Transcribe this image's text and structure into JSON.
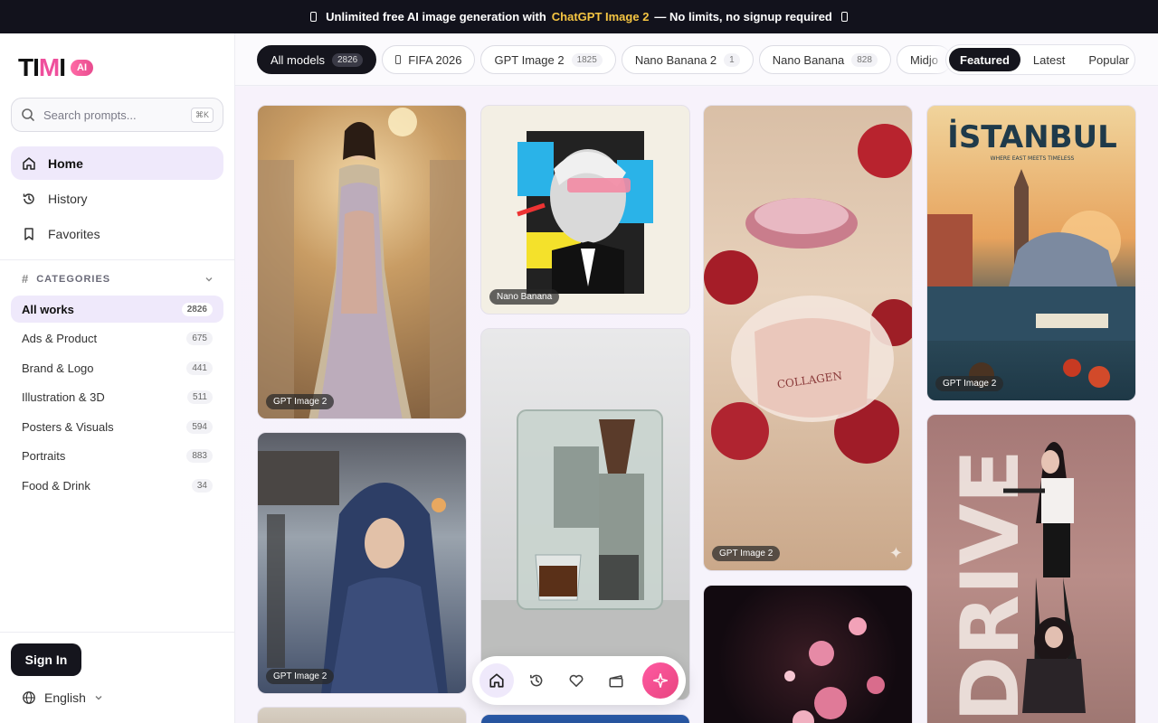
{
  "banner": {
    "prefix": "Unlimited free AI image generation with",
    "highlight": "ChatGPT Image 2",
    "suffix": "— No limits, no signup required"
  },
  "logo": {
    "text_a": "TI",
    "text_m": "M",
    "text_b": "I",
    "badge": "AI"
  },
  "search": {
    "placeholder": "Search prompts...",
    "shortcut": "⌘K"
  },
  "nav": [
    {
      "label": "Home",
      "icon": "home-icon",
      "active": true
    },
    {
      "label": "History",
      "icon": "history-icon"
    },
    {
      "label": "Favorites",
      "icon": "bookmark-icon"
    }
  ],
  "categories": {
    "heading": "CATEGORIES",
    "items": [
      {
        "label": "All works",
        "count": "2826",
        "active": true
      },
      {
        "label": "Ads & Product",
        "count": "675"
      },
      {
        "label": "Brand & Logo",
        "count": "441"
      },
      {
        "label": "Illustration & 3D",
        "count": "511"
      },
      {
        "label": "Posters & Visuals",
        "count": "594"
      },
      {
        "label": "Portraits",
        "count": "883"
      },
      {
        "label": "Food & Drink",
        "count": "34"
      }
    ]
  },
  "auth": {
    "sign_in": "Sign In"
  },
  "language": {
    "label": "English"
  },
  "models": [
    {
      "label": "All models",
      "count": "2826",
      "active": true
    },
    {
      "label": "FIFA 2026",
      "count": ""
    },
    {
      "label": "GPT Image 2",
      "count": "1825"
    },
    {
      "label": "Nano Banana 2",
      "count": "1"
    },
    {
      "label": "Nano Banana",
      "count": "828"
    },
    {
      "label": "Midjo",
      "count": ""
    }
  ],
  "sort": {
    "featured": "Featured",
    "latest": "Latest",
    "popular": "Popular",
    "active": "Featured"
  },
  "gallery": {
    "tags": [
      "GPT Image 2",
      "GPT Image 2",
      "Nano Banana",
      "GPT Image 2",
      "GPT Image 2"
    ],
    "poster_title": "İSTANBUL",
    "poster_subtitle": "WHERE EAST MEETS TIMELESS",
    "jar_text": "COLLAGEN",
    "poster2_text": "DRIVE"
  },
  "colors": {
    "accent": "#ef4f9c",
    "dark": "#15151d",
    "active_bg": "#efe9fb",
    "banner_highlight": "#f5c542"
  }
}
